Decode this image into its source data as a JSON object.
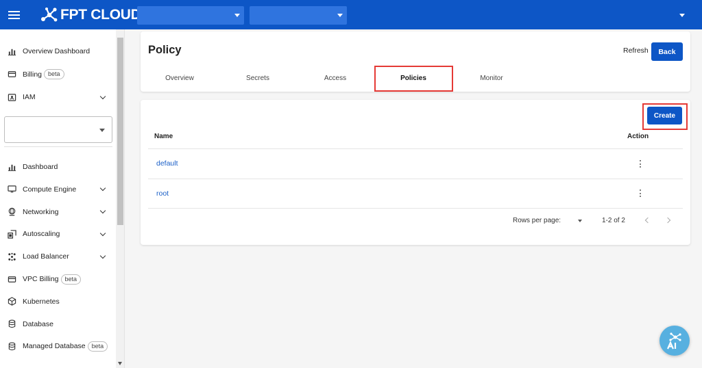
{
  "topbar": {
    "brand": "FPT CLOUD",
    "select1_value": "",
    "select2_value": ""
  },
  "sidebar": {
    "items_top": [
      {
        "label": "Overview Dashboard",
        "icon": "bar-chart-icon"
      },
      {
        "label": "Billing",
        "badge": "beta",
        "icon": "billing-icon"
      },
      {
        "label": "IAM",
        "icon": "iam-icon",
        "expandable": true
      }
    ],
    "project_select_value": "",
    "items_main": [
      {
        "label": "Dashboard",
        "icon": "bar-chart-icon"
      },
      {
        "label": "Compute Engine",
        "icon": "monitor-icon",
        "expandable": true
      },
      {
        "label": "Networking",
        "icon": "globe-icon",
        "expandable": true
      },
      {
        "label": "Autoscaling",
        "icon": "autoscaling-icon",
        "expandable": true
      },
      {
        "label": "Load Balancer",
        "icon": "load-balancer-icon",
        "expandable": true
      },
      {
        "label": "VPC Billing",
        "badge": "beta",
        "icon": "billing-icon"
      },
      {
        "label": "Kubernetes",
        "icon": "cube-icon"
      },
      {
        "label": "Database",
        "icon": "database-icon"
      },
      {
        "label": "Managed Database",
        "badge": "beta",
        "icon": "database-icon"
      }
    ]
  },
  "header": {
    "title": "Policy",
    "refresh_label": "Refresh",
    "back_label": "Back",
    "tabs": [
      {
        "label": "Overview"
      },
      {
        "label": "Secrets"
      },
      {
        "label": "Access"
      },
      {
        "label": "Policies",
        "active": true
      },
      {
        "label": "Monitor"
      }
    ]
  },
  "policies": {
    "create_label": "Create",
    "columns": [
      "Name",
      "Action"
    ],
    "rows": [
      {
        "name": "default"
      },
      {
        "name": "root"
      }
    ]
  },
  "pagination": {
    "rows_per_page_label": "Rows per page:",
    "range": "1-2 of 2"
  },
  "colors": {
    "brand_blue": "#0d56c6",
    "link_blue": "#1a5fc7",
    "highlight_red": "#e53935",
    "ai_bubble": "#57b0e0"
  }
}
